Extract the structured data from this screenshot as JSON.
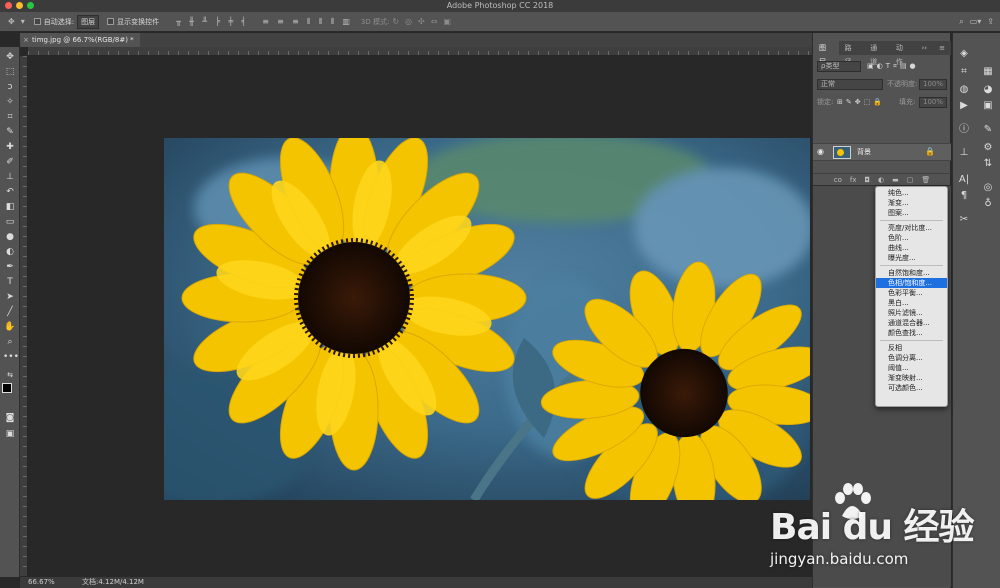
{
  "window": {
    "title": "Adobe Photoshop CC 2018"
  },
  "options_bar": {
    "auto_select_label": "自动选择:",
    "auto_select_value": "图层",
    "transform_controls_label": "显示变换控件",
    "mode_3d_label": "3D 模式:"
  },
  "document": {
    "tab_title": "timg.jpg @ 66.7%(RGB/8#) *",
    "close_glyph": "×"
  },
  "layers_panel": {
    "tabs": [
      "图层",
      "路径",
      "通道",
      "动作"
    ],
    "filter_label": "ρ类型",
    "blend_mode": "正常",
    "opacity_label": "不透明度:",
    "opacity_value": "100%",
    "lock_label": "锁定:",
    "fill_label": "填充:",
    "fill_value": "100%",
    "layers": [
      {
        "name": "背景",
        "visible": true,
        "locked": true
      }
    ],
    "bottom_icons": [
      "co",
      "fx"
    ]
  },
  "adjustment_menu": {
    "groups": [
      [
        "纯色...",
        "渐变...",
        "图案..."
      ],
      [
        "亮度/对比度...",
        "色阶...",
        "曲线...",
        "曝光度..."
      ],
      [
        "自然饱和度...",
        "色相/饱和度...",
        "色彩平衡...",
        "黑白...",
        "照片滤镜...",
        "通道混合器...",
        "颜色查找..."
      ],
      [
        "反相",
        "色调分离...",
        "阈值...",
        "渐变映射...",
        "可选颜色..."
      ]
    ],
    "highlighted": "色相/饱和度..."
  },
  "status_bar": {
    "zoom": "66.67%",
    "doc_size": "文档:4.12M/4.12M"
  },
  "watermark": {
    "brand": "Bai  du 经验",
    "url": "jingyan.baidu.com"
  },
  "colors": {
    "accent": "#1e6fe0",
    "sunflower": "#f4c400",
    "foliage": "#3b6a8a"
  }
}
